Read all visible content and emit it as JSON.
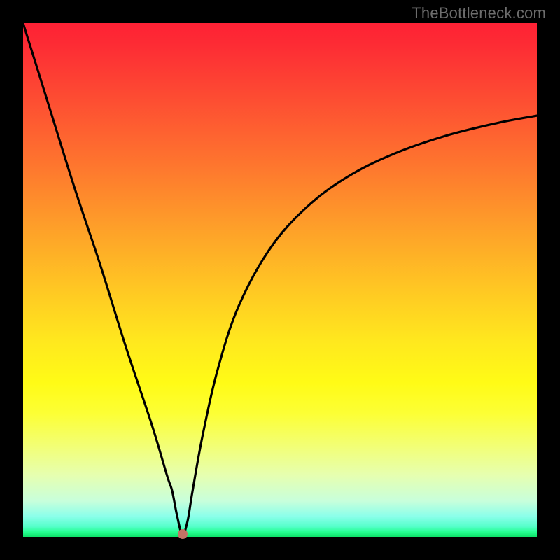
{
  "watermark": "TheBottleneck.com",
  "colors": {
    "frame": "#000000",
    "curve": "#000000",
    "dot": "#c47365"
  },
  "chart_data": {
    "type": "line",
    "title": "",
    "xlabel": "",
    "ylabel": "",
    "xlim": [
      0,
      100
    ],
    "ylim": [
      0,
      100
    ],
    "grid": false,
    "legend": false,
    "series": [
      {
        "name": "bottleneck-curve",
        "x": [
          0,
          5,
          10,
          15,
          20,
          25,
          28,
          29,
          30,
          31,
          32,
          33,
          35,
          38,
          42,
          48,
          55,
          63,
          72,
          82,
          92,
          100
        ],
        "y": [
          100,
          84,
          68,
          53,
          37,
          22,
          12,
          9,
          4,
          0.5,
          3,
          9,
          20,
          33,
          45,
          56,
          64,
          70,
          74.5,
          78,
          80.5,
          82
        ]
      }
    ],
    "marker": {
      "x": 31,
      "y": 0.5
    },
    "background_gradient": [
      "#fe2135",
      "#fd2b34",
      "#fd4433",
      "#fe772e",
      "#fea029",
      "#ffc823",
      "#ffe81e",
      "#fffb16",
      "#fcff35",
      "#f3ff72",
      "#e6ffb0",
      "#c8ffdb",
      "#8bffea",
      "#55ffca",
      "#27ff93",
      "#0ee26a"
    ]
  }
}
